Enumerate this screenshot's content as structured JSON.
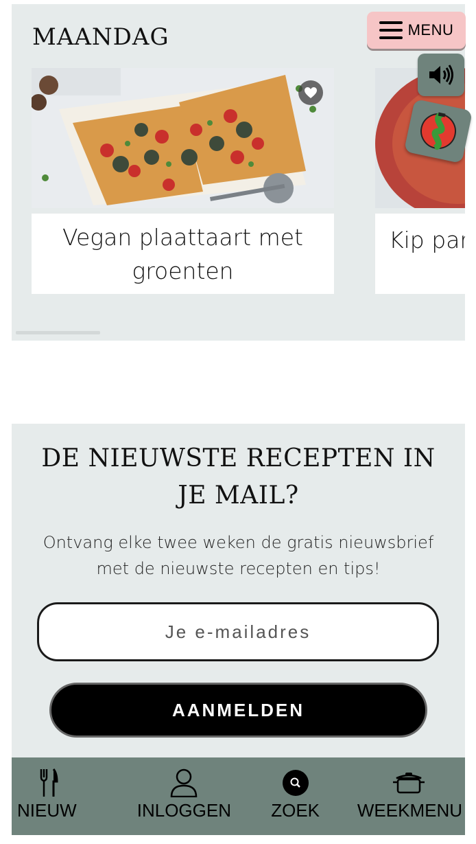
{
  "weekmenu": {
    "day": "MAANDAG",
    "recipes": [
      {
        "title": "Vegan plaattaart met groenten"
      },
      {
        "title": "Kip par"
      }
    ]
  },
  "floating": {
    "menu_label": "MENU",
    "sound_icon": "speaker-icon",
    "brand_icon": "brand-logo-icon"
  },
  "newsletter": {
    "title": "DE NIEUWSTE RECEPTEN IN JE MAIL?",
    "text": "Ontvang elke twee weken de gratis nieuwsbrief met de nieuwste recepten en tips!",
    "email_placeholder": "Je e-mailadres",
    "submit_label": "AANMELDEN"
  },
  "bottom_nav": [
    {
      "label": "NIEUW",
      "icon": "fork-knife-icon"
    },
    {
      "label": "INLOGGEN",
      "icon": "user-icon"
    },
    {
      "label": "ZOEK",
      "icon": "search-icon"
    },
    {
      "label": "WEEKMENU",
      "icon": "pot-icon"
    }
  ],
  "colors": {
    "section_bg": "#e6ebeb",
    "nav_bg": "#6f837c",
    "menu_button_bg": "#f6c5c6"
  }
}
